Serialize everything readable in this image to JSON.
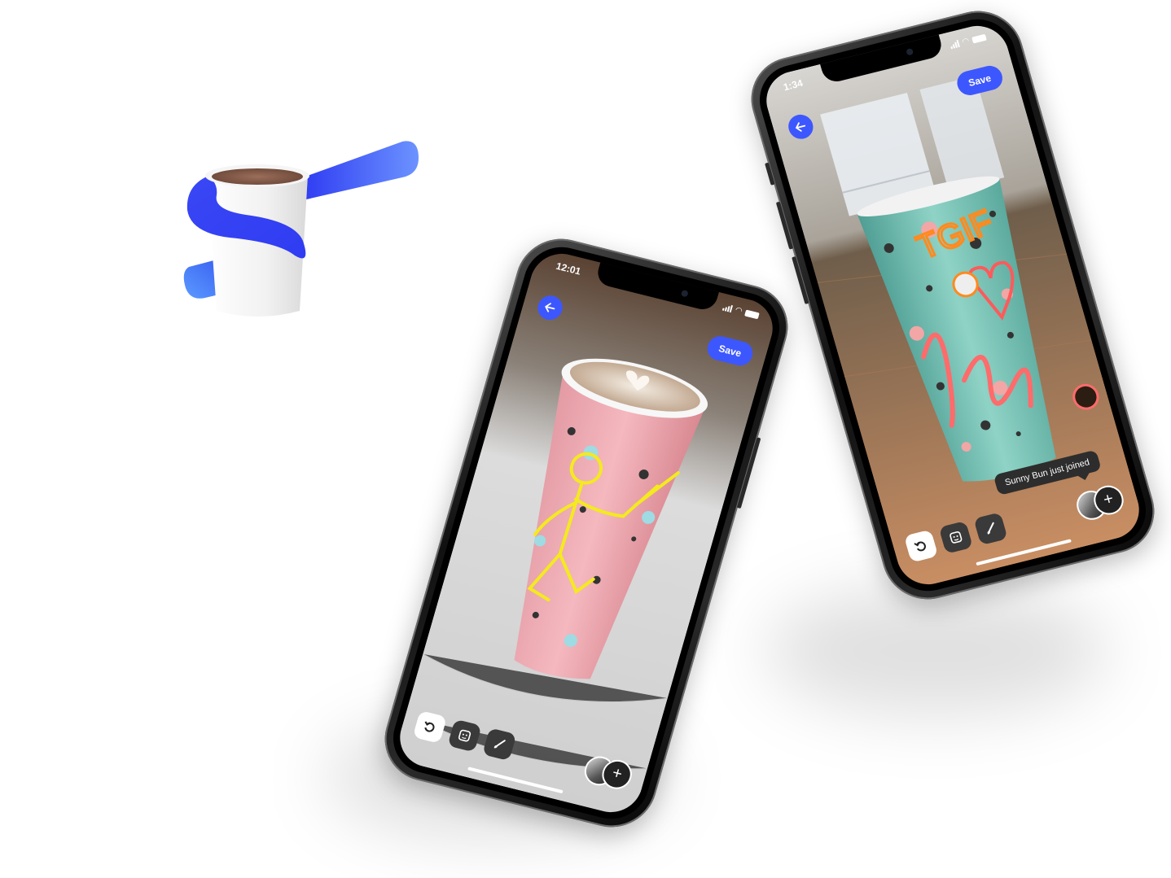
{
  "brand": {
    "colors": {
      "primary": "#3d57ff",
      "primary_light": "#5f8bff",
      "cup_white": "#f3f3f3",
      "coffee": "#7a5443"
    }
  },
  "phone_front": {
    "status_time": "12:01",
    "save_label": "Save",
    "back_icon": "arrow-left-icon",
    "tools": [
      "undo-icon",
      "sticker-icon",
      "brush-icon"
    ],
    "add_label": "+",
    "drawing_color": "#f4ea1e"
  },
  "phone_back": {
    "status_time": "1:34",
    "save_label": "Save",
    "back_icon": "arrow-left-icon",
    "tools": [
      "undo-icon",
      "sticker-icon",
      "brush-icon"
    ],
    "add_label": "+",
    "toast": "Sunny Bun just joined",
    "doodle_text": "TGIF",
    "drawing_colors": [
      "#ff8a1e",
      "#ff5a5a"
    ]
  }
}
